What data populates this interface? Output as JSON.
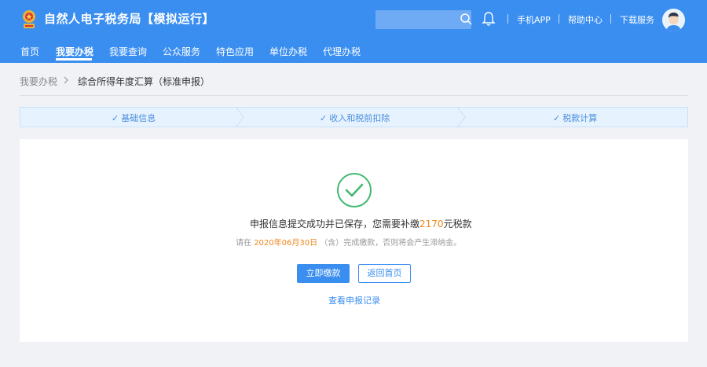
{
  "header": {
    "site_title": "自然人电子税务局【模拟运行】",
    "search_placeholder": "",
    "links": [
      "手机APP",
      "帮助中心",
      "下载服务"
    ],
    "brand_color": "#3a8ef0",
    "icons": [
      "emblem-logo-icon",
      "search-icon",
      "bell-icon",
      "user-avatar-icon"
    ]
  },
  "nav": {
    "items": [
      "首页",
      "我要办税",
      "我要查询",
      "公众服务",
      "特色应用",
      "单位办税",
      "代理办税"
    ],
    "active": "我要办税"
  },
  "breadcrumb": {
    "parent": "我要办税",
    "current": "综合所得年度汇算（标准申报）"
  },
  "steps": [
    {
      "check": "✓",
      "label": "基础信息"
    },
    {
      "check": "✓",
      "label": "收入和税前扣除"
    },
    {
      "check": "✓",
      "label": "税款计算"
    }
  ],
  "result": {
    "icon": "check-circle-icon",
    "success_color": "#3fb96f",
    "main_prefix": "申报信息提交成功并已保存，您需要补缴",
    "amount": "2170",
    "main_suffix": "元税款",
    "sub_prefix": "请在",
    "deadline": "2020年06月30日",
    "sub_suffix": "（含）完成缴款，否则将会产生滞纳金。",
    "accent_color": "#f0861c"
  },
  "actions": {
    "pay_label": "立即缴款",
    "home_label": "返回首页",
    "records_link": "查看申报记录"
  }
}
